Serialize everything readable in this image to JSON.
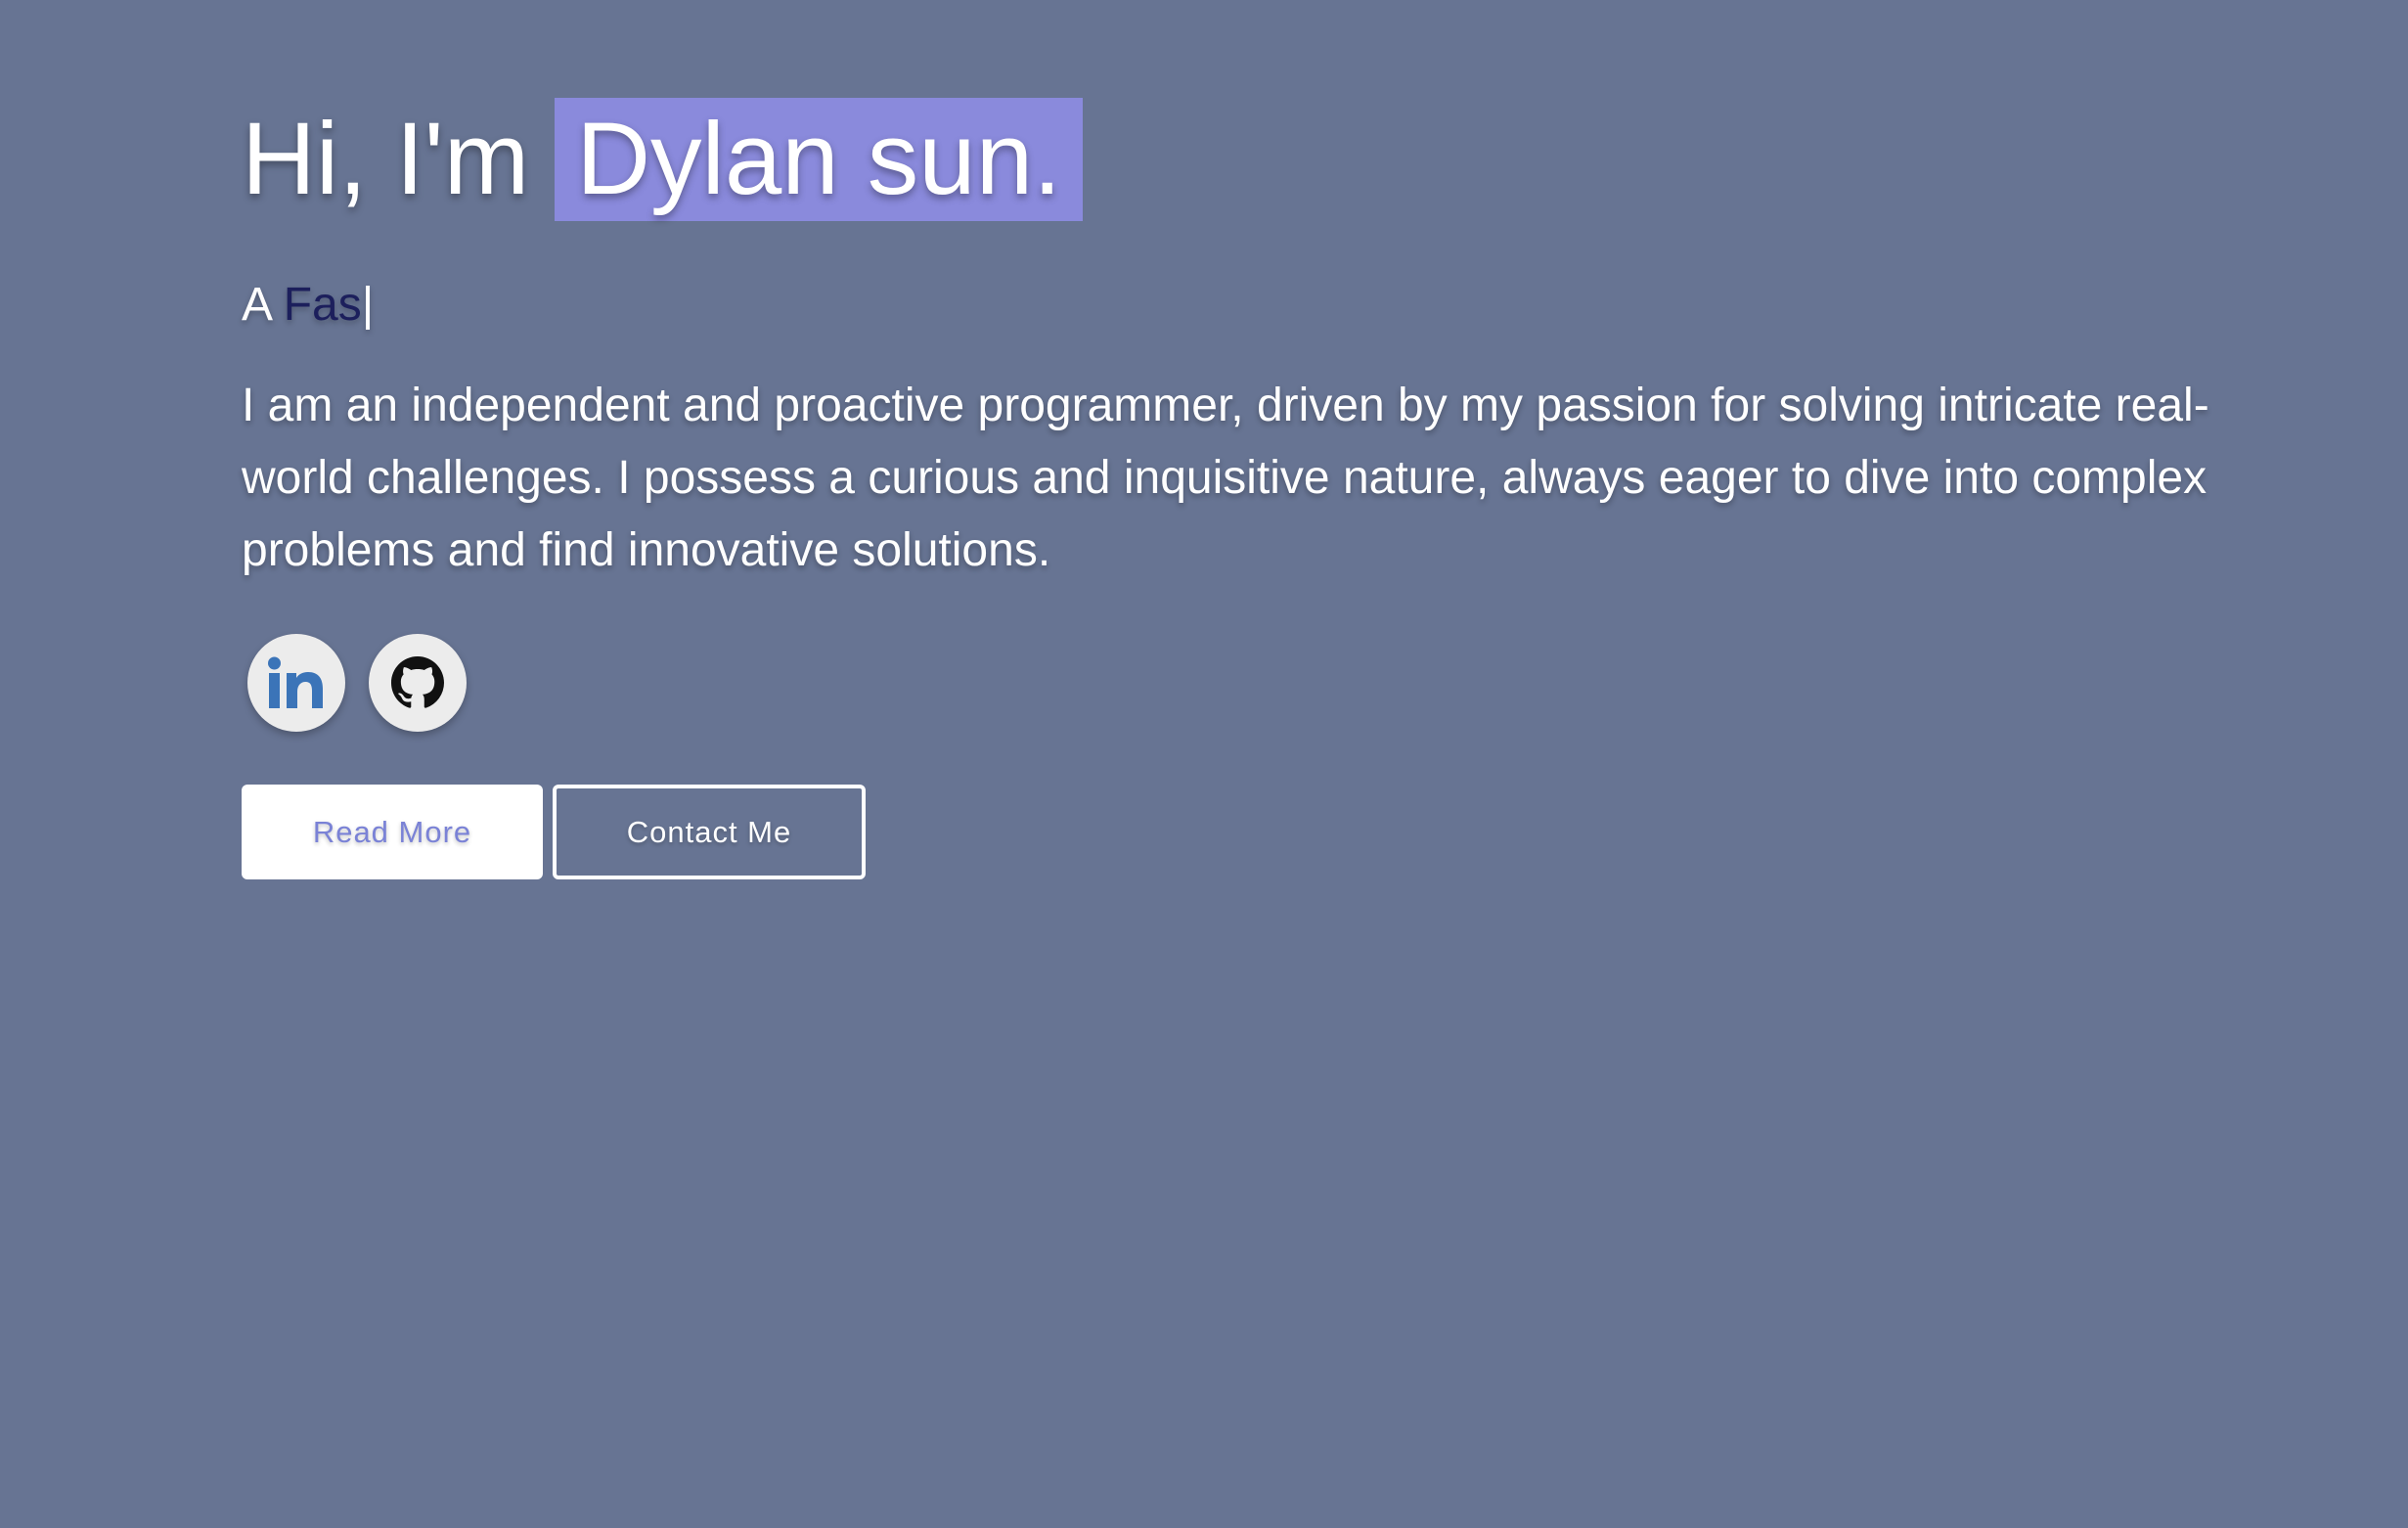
{
  "hero": {
    "greeting": "Hi, I'm",
    "name": "Dylan sun.",
    "role_prefix": "A",
    "role_typed": "Fas",
    "cursor": "|",
    "about": "I am an independent and proactive programmer, driven by my passion for solving intricate real-world challenges. I possess a curious and inquisitive nature, always eager to dive into complex problems and find innovative solutions."
  },
  "socials": [
    {
      "icon": "linkedin-icon"
    },
    {
      "icon": "github-icon"
    }
  ],
  "buttons": {
    "read_more": "Read More",
    "contact_me": "Contact Me"
  },
  "colors": {
    "background": "#677493",
    "name_highlight": "#8a8adc",
    "typed_text": "#1c1f5c",
    "linkedin_blue": "#3b74b8",
    "primary_button_text": "#7a82d6"
  }
}
